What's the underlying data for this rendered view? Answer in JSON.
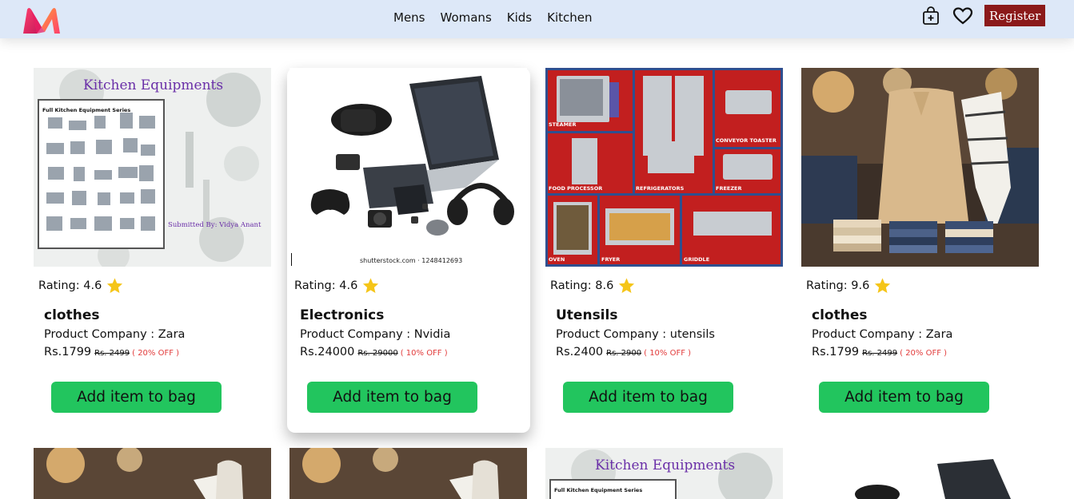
{
  "nav": {
    "logo": "myntra-logo",
    "links": [
      "Mens",
      "Womans",
      "Kids",
      "Kitchen"
    ],
    "register_label": "Register",
    "icons": [
      "bag-add-icon",
      "heart-icon"
    ]
  },
  "colors": {
    "navbar_bg": "#dde8f8",
    "register_bg": "#8b1a1a",
    "add_button_bg": "#22c55e",
    "discount": "#e23b3b",
    "star": "#f5c518"
  },
  "products": [
    {
      "rating_label": "Rating: 4.6",
      "name": "clothes",
      "company": "Product Company : Zara",
      "price": "Rs.1799",
      "original_price": "Rs. 2499",
      "discount": "( 20% OFF )",
      "button": "Add item to bag",
      "image": {
        "title": "Kitchen Equipments",
        "subtitle": "Full Kitchen Equipment Series",
        "credit": "Submitted By: Vidya Anant"
      }
    },
    {
      "rating_label": "Rating: 4.6",
      "name": "Electronics",
      "company": "Product Company : Nvidia",
      "price": "Rs.24000",
      "original_price": "Rs. 29000",
      "discount": "( 10% OFF )",
      "button": "Add item to bag",
      "image": {
        "credit": "shutterstock.com · 1248412693"
      }
    },
    {
      "rating_label": "Rating: 8.6",
      "name": "Utensils",
      "company": "Product Company : utensils",
      "price": "Rs.2400",
      "original_price": "Rs. 2900",
      "discount": "( 10% OFF )",
      "button": "Add item to bag",
      "image": {
        "labels": [
          "STEAMER",
          "CONVEYOR TOASTER",
          "FOOD PROCESSOR",
          "REFRIGERATORS",
          "FREEZER",
          "OVEN",
          "FRYER",
          "GRIDDLE"
        ]
      }
    },
    {
      "rating_label": "Rating: 9.6",
      "name": "clothes",
      "company": "Product Company : Zara",
      "price": "Rs.1799",
      "original_price": "Rs. 2499",
      "discount": "( 20% OFF )",
      "button": "Add item to bag",
      "image": {}
    }
  ],
  "row2_images": {
    "kitchen_title": "Kitchen Equipments",
    "kitchen_subtitle": "Full Kitchen Equipment Series"
  }
}
